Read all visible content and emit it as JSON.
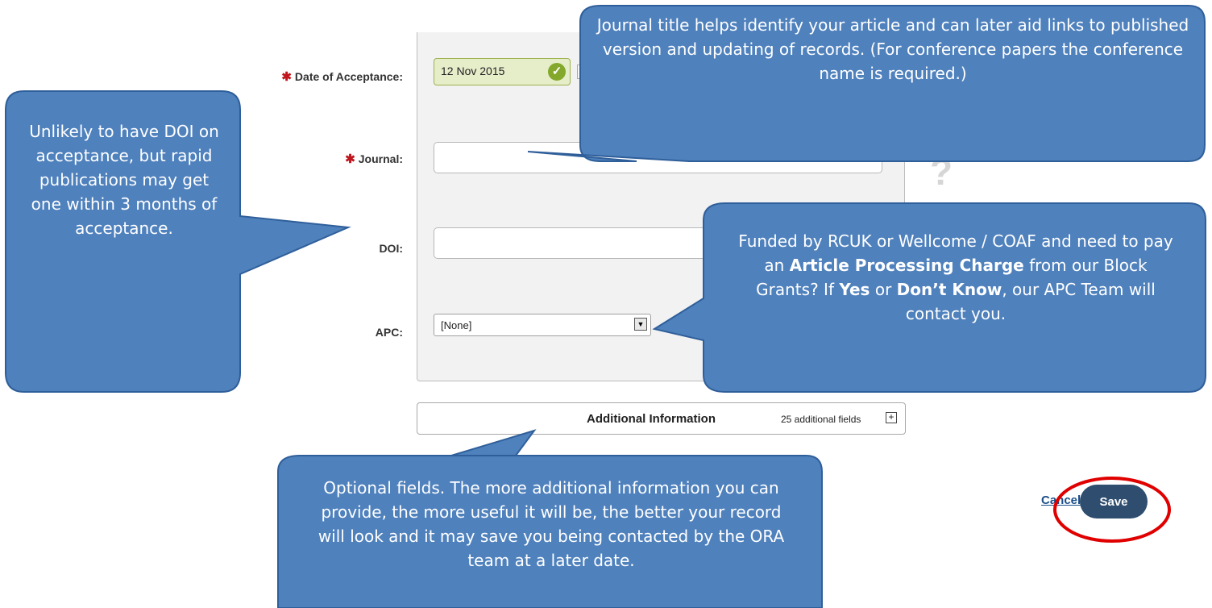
{
  "form": {
    "date_label": "Date of Acceptance:",
    "date_value": "12 Nov 2015",
    "journal_label": "Journal:",
    "journal_value": "",
    "doi_label": "DOI:",
    "doi_value": "",
    "apc_label": "APC:",
    "apc_value": "[None]",
    "required_marker": "✱",
    "help_icon": "?"
  },
  "additional": {
    "title": "Additional Information",
    "count": "25 additional fields",
    "toggle": "+"
  },
  "actions": {
    "cancel": "Cancel",
    "save": "Save"
  },
  "callouts": {
    "journal": "Journal title helps identify your article and can later aid links to published version and updating of records. (For conference papers the conference name is required.)",
    "doi": "Unlikely to have DOI on acceptance, but rapid publications may get one within 3 months of acceptance.",
    "apc_1": "Funded by RCUK or Wellcome / COAF and need to pay an ",
    "apc_2": "Article Processing Charge",
    "apc_3": " from our Block Grants? If ",
    "apc_4": "Yes",
    "apc_5": " or ",
    "apc_6": "Don’t Know",
    "apc_7": ", our APC Team will contact you.",
    "optional": "Optional fields. The more additional information you can provide, the more useful it will be, the better your record will look and it may save you being contacted by the ORA team at a later date."
  },
  "colors": {
    "callout_fill": "#4f81bd",
    "callout_border": "#2f5f9a",
    "highlight_ring": "#e00000",
    "save_button": "#2e4d6f"
  }
}
